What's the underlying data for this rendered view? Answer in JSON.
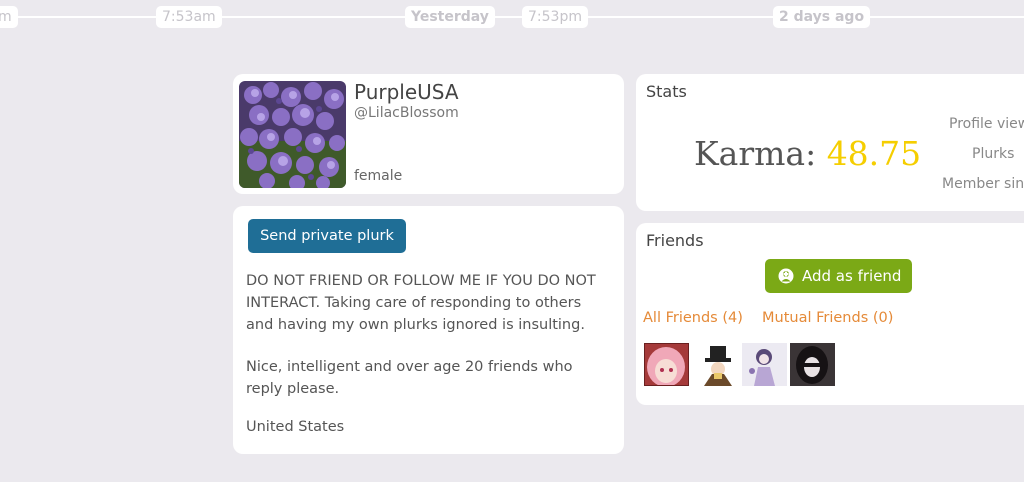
{
  "timeline": {
    "labels": [
      {
        "text": "m"
      },
      {
        "text": "7:53am"
      },
      {
        "text": "Yesterday"
      },
      {
        "text": "7:53pm"
      },
      {
        "text": "2 days ago"
      }
    ]
  },
  "profile": {
    "display_name": "PurpleUSA",
    "nick": "@LilacBlossom",
    "gender": "female",
    "avatar_icon": "lilac-flowers-photo"
  },
  "about": {
    "private_button": "Send private plurk",
    "paragraph1": "DO NOT FRIEND OR FOLLOW ME IF YOU DO NOT INTERACT. Taking care of responding to others and having my own plurks ignored is insulting.",
    "paragraph2": "Nice, intelligent and over age 20 friends who reply please.",
    "location": "United States"
  },
  "stats": {
    "title": "Stats",
    "karma_label": "Karma:",
    "karma_value": "48.75",
    "karma_color": "#f5ce00",
    "rows": [
      "Profile views",
      "Plurks",
      "Member since"
    ]
  },
  "friends": {
    "title": "Friends",
    "add_button": "Add as friend",
    "all_friends": "All Friends (4)",
    "mutual_friends": "Mutual Friends (0)",
    "thumbnails": [
      "pink-haired-anime-avatar",
      "top-hat-character-avatar",
      "purple-girl-avatar",
      "dark-haired-avatar"
    ]
  },
  "colors": {
    "private_button": "#1f6e96",
    "add_friend_button": "#7ba916",
    "friend_links": "#e58a38"
  }
}
